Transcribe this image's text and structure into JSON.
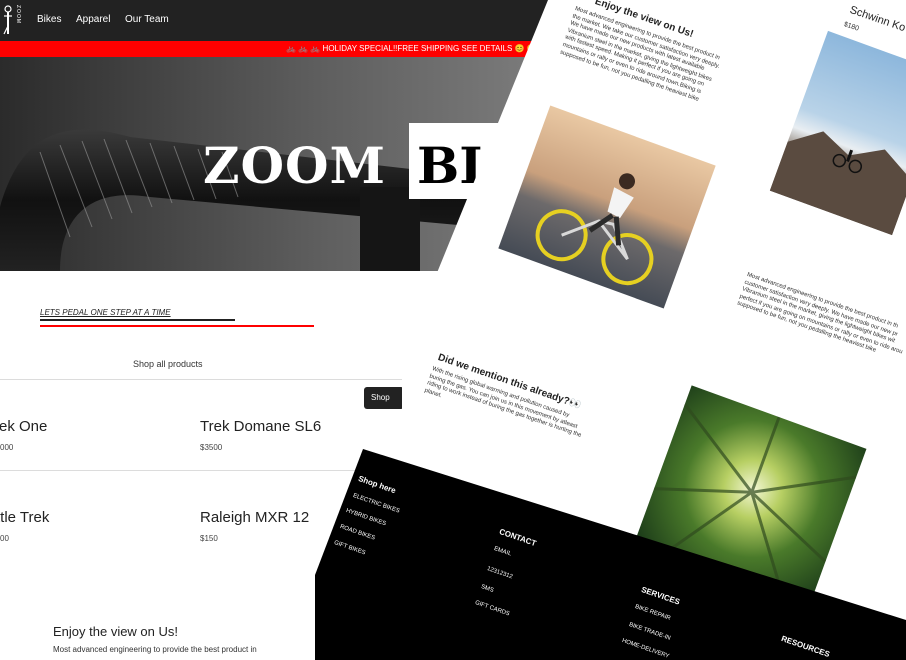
{
  "nav": {
    "logo_text": "ZOOM",
    "links": [
      "Bikes",
      "Apparel",
      "Our Team"
    ]
  },
  "promo_text": "🚲 🚲 🚲 HOLIDAY SPECIAL!!FREE SHIPPING SEE DETAILS 😊 😊",
  "hero": {
    "title_white": "ZOOM",
    "title_black": "BI"
  },
  "tagline": "LETS PEDAL ONE STEP AT A TIME",
  "shop_all": "Shop all products",
  "shop_button": "Shop",
  "products": [
    {
      "name": "rek One",
      "price": "000"
    },
    {
      "name": "Trek Domane SL6",
      "price": "$3500"
    },
    {
      "name": "ttle Trek",
      "price": "00"
    },
    {
      "name": "Raleigh MXR 12",
      "price": "$150"
    }
  ],
  "enjoy": {
    "title": "Enjoy the view on Us!",
    "text": "Most advanced engineering to provide the best product in"
  },
  "second_page": {
    "enjoy_title": "Enjoy the view on Us!",
    "enjoy_lines": [
      "Most advanced engineering to provide the best product in",
      "the market. We take our customer satisfaction very deeply.",
      "We have made our new products with latest available",
      "Vibranium steel in the market, giving the lightweight bikes",
      "with fastest speed. Making it perfect if you are going on",
      "mountains or rally or even to ride around town.Biking is",
      "supposed to be fun, not you pedalling the heaviest bike"
    ],
    "featured_name": "Schwinn Ko",
    "featured_price": "$180",
    "right_lines": [
      "Most advanced engineering to provide the best product in th",
      "customer satisfaction very deeply. We have made our new pr",
      "Vibranium steel in the market, giving the lightweight bikes wit",
      "perfect if you are going on mountains or rally or even to ride arou",
      "supposed to be fun, not you pedalling the heaviest bike"
    ],
    "mention_title": "Did we mention this already?👀",
    "mention_lines": [
      "With the rising global warming and pollution caused by",
      "buring the gas. You can join us in this movement by atleast",
      "riding to work instead of buring the gas together is hurting the",
      "planet."
    ]
  },
  "footer": {
    "shop": {
      "title": "Shop here",
      "links": [
        "ELECTRIC BIKES",
        "HYBRID BIKES",
        "ROAD BIKES",
        "GIFT BIKES"
      ]
    },
    "contact": {
      "title": "CONTACT",
      "links": [
        "EMAIL",
        "12312312",
        "SMS",
        "GIFT CARDS"
      ]
    },
    "services": {
      "title": "SERVICES",
      "links": [
        "BIKE REPAIR",
        "BIKE TRADE-IN",
        "HOME-DELIVERY"
      ]
    },
    "resources": {
      "title": "RESOURCES"
    }
  },
  "colors": {
    "navbar": "#222222",
    "promo": "#ff0000",
    "footer": "#000000",
    "accent_line": "#ff0000"
  }
}
